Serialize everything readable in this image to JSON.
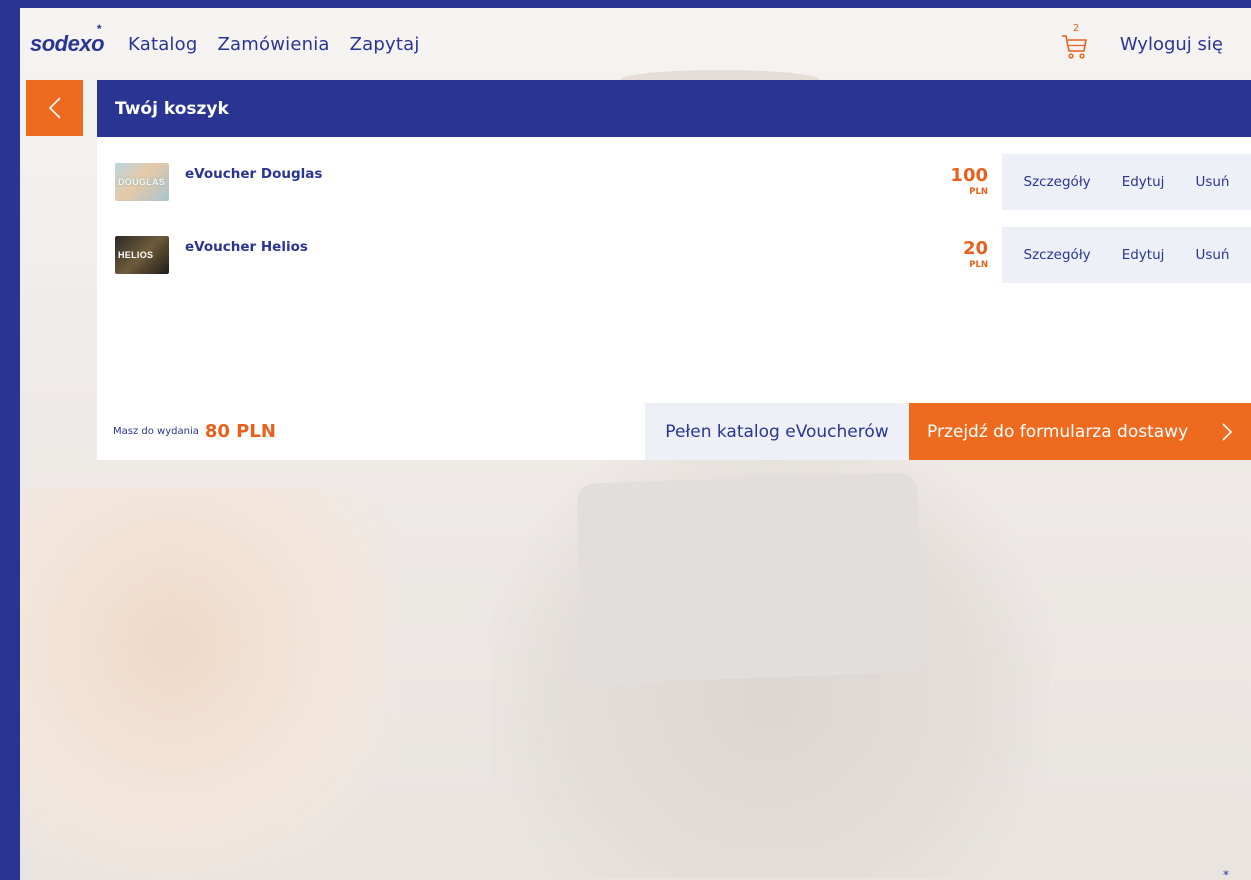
{
  "brand": {
    "logo_text": "sodexo",
    "logo_star": "*"
  },
  "nav": {
    "links": [
      "Katalog",
      "Zamówienia",
      "Zapytaj"
    ],
    "cart_count": "2",
    "logout_label": "Wyloguj się"
  },
  "cart": {
    "title": "Twój koszyk",
    "items": [
      {
        "name": "eVoucher Douglas",
        "thumb_label": "DOUGLAS",
        "price": "100",
        "currency": "PLN",
        "actions": {
          "details": "Szczegóły",
          "edit": "Edytuj",
          "remove": "Usuń"
        }
      },
      {
        "name": "eVoucher Helios",
        "thumb_label": "HELIOS",
        "price": "20",
        "currency": "PLN",
        "actions": {
          "details": "Szczegóły",
          "edit": "Edytuj",
          "remove": "Usuń"
        }
      }
    ],
    "budget_label": "Masz do wydania",
    "budget_value": "80 PLN",
    "catalog_button": "Pełen katalog eVoucherów",
    "checkout_button": "Przejdź do formularza dostawy"
  },
  "colors": {
    "brand_blue": "#2a3593",
    "accent_orange": "#ee6a1f",
    "price_orange": "#e8601c",
    "light_panel": "#eef0f8"
  },
  "icons": {
    "back": "chevron-left-icon",
    "cart": "cart-icon",
    "checkout": "chevron-right-icon"
  }
}
